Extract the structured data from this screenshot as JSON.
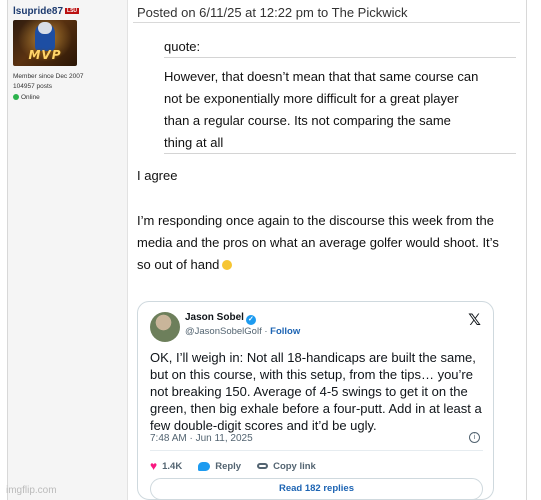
{
  "user": {
    "username": "lsupride87",
    "member_since": "Member since Dec 2007",
    "posts": "104957 posts",
    "status": "Online",
    "avatar_badge": "MVP"
  },
  "post": {
    "header": "Posted on 6/11/25 at 12:22 pm to The Pickwick",
    "quote_label": "quote:",
    "quote_lines": [
      "However, that doesn’t mean that that same course can",
      "not be exponentially more difficult for a great player",
      "than a regular course. Its not comparing the same",
      "thing at all"
    ],
    "agree": "I agree",
    "body_lines": [
      "I’m responding once again to the discourse this week from the",
      "media and the pros on what an average golfer would shoot. It’s",
      "so out of hand"
    ]
  },
  "tweet": {
    "name": "Jason Sobel",
    "handle": "@JasonSobelGolf",
    "separator": " · ",
    "follow": "Follow",
    "text_lines": [
      "OK, I’ll weigh in: Not all 18-handicaps are built the same,",
      "but on this course, with this setup, from the tips… you’re",
      "not breaking 150. Average of 4-5 swings to get it on the",
      "green, then big exhale before a four-putt. Add in at least a",
      "few double-digit scores and it’d be ugly."
    ],
    "timestamp": "7:48 AM · Jun 11, 2025",
    "likes": "1.4K",
    "reply": "Reply",
    "copy_link": "Copy link",
    "read_replies": "Read 182 replies",
    "icons": [
      "x-logo-icon",
      "verified-badge-icon",
      "heart-icon",
      "reply-icon",
      "link-icon",
      "info-icon"
    ]
  },
  "watermark": "imgflip.com",
  "colors": {
    "link_blue": "#1d64b3",
    "twitter_blue": "#1d9bf0",
    "heart_pink": "#f91880",
    "online_green": "#2bb24c"
  }
}
